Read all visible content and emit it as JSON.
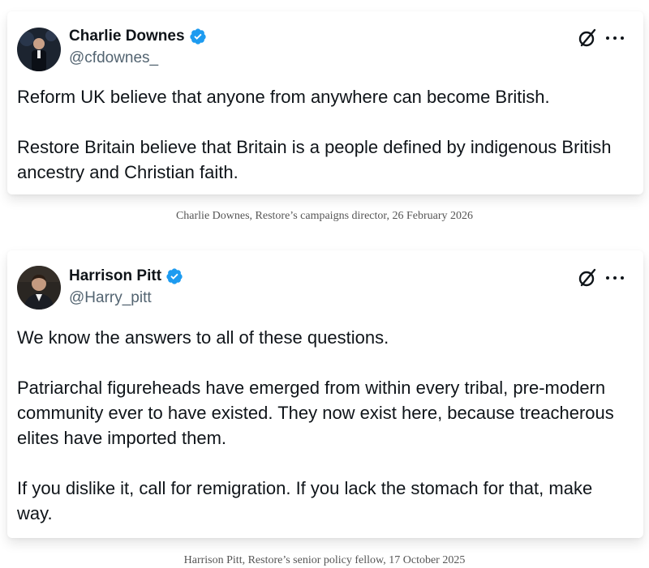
{
  "posts": [
    {
      "display_name": "Charlie Downes",
      "handle": "@cfdownes_",
      "verified": true,
      "paragraphs": [
        "Reform UK believe that anyone from anywhere can become British.",
        "Restore Britain believe that Britain is a people defined by indigenous British ancestry and Christian faith."
      ],
      "caption": "Charlie Downes, Restore’s campaigns director, 26 February 2026"
    },
    {
      "display_name": "Harrison Pitt",
      "handle": "@Harry_pitt",
      "verified": true,
      "paragraphs": [
        "We know the answers to all of these questions.",
        "Patriarchal figureheads have emerged from within every tribal, pre-modern community ever to have existed. They now exist here, because treacherous elites have imported them.",
        "If you dislike it, call for remigration. If you lack the stomach for that, make way."
      ],
      "caption": "Harrison Pitt, Restore’s senior policy fellow, 17 October 2025"
    }
  ],
  "icons": {
    "verified_badge": "verified-badge-icon",
    "grok": "grok-icon",
    "more": "more-icon"
  },
  "colors": {
    "verified_blue": "#1d9bf0",
    "text_primary": "#0f1419",
    "text_secondary": "#536471",
    "caption_gray": "#555555"
  }
}
